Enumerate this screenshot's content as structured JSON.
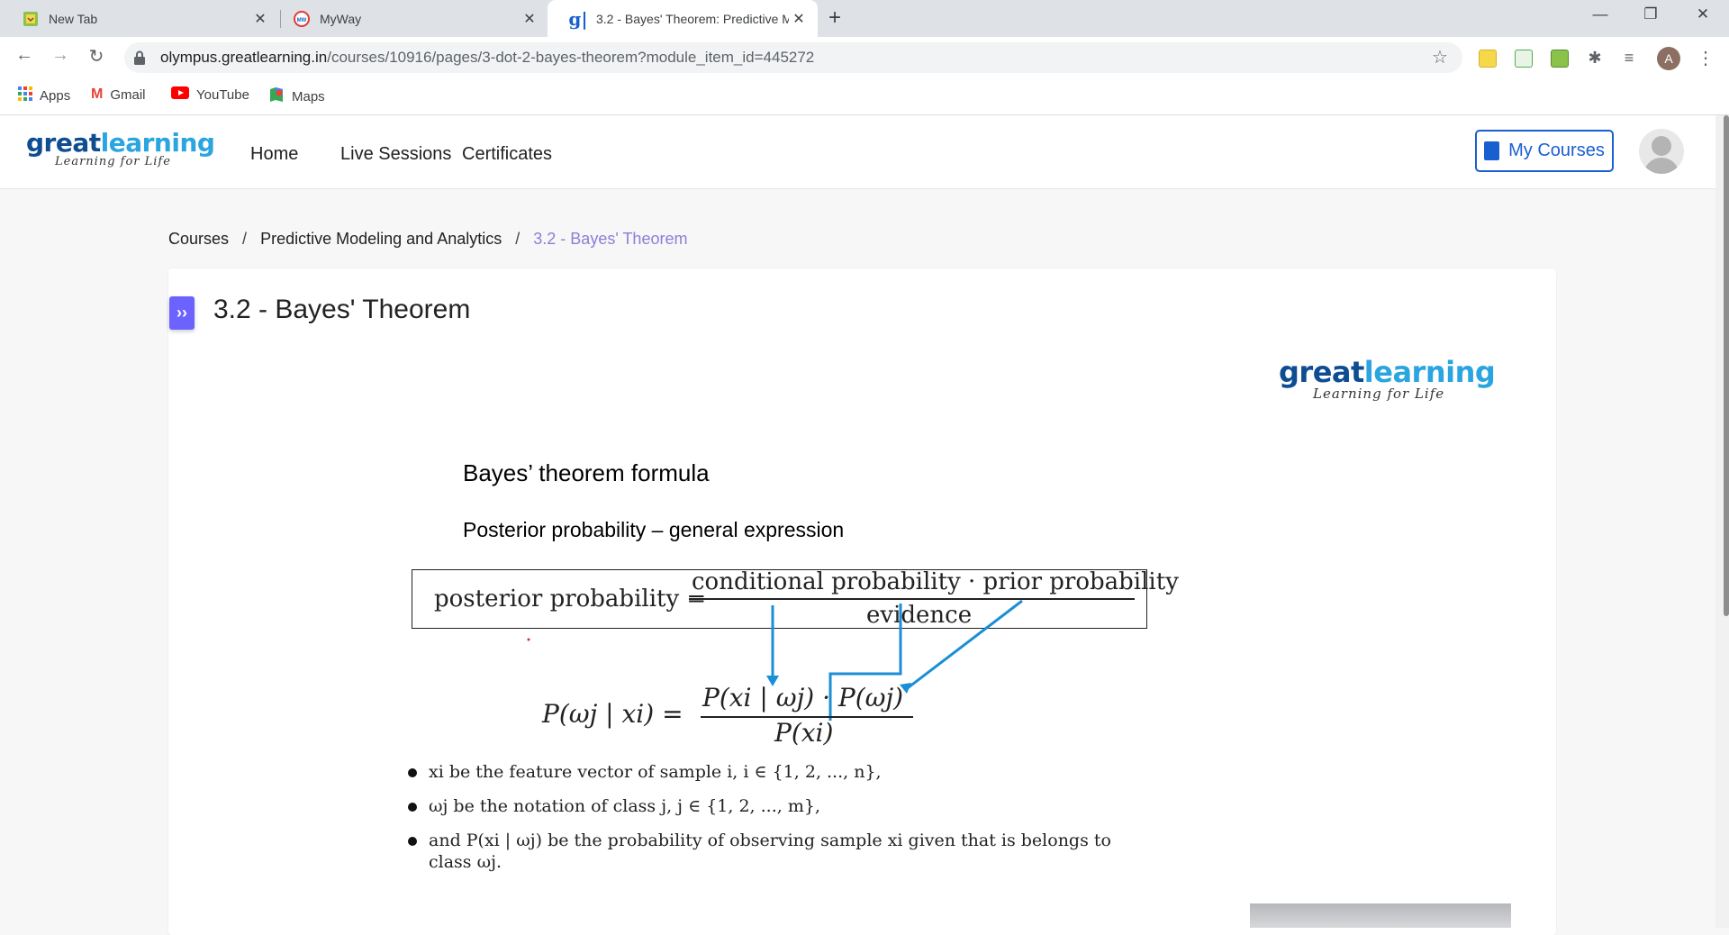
{
  "browser": {
    "tabs": [
      {
        "title": "New Tab",
        "close": "✕"
      },
      {
        "title": "MyWay",
        "close": "✕"
      },
      {
        "title": "3.2 - Bayes' Theorem: Predictive Mo",
        "close": "✕"
      }
    ],
    "new_tab": "+",
    "window_controls": {
      "minimize": "—",
      "restore": "❐",
      "close": "✕"
    },
    "url_host": "olympus.greatlearning.in",
    "url_path": "/courses/10916/pages/3-dot-2-bayes-theorem?module_item_id=445272",
    "profile_initial": "A",
    "bookmarks": [
      "Apps",
      "Gmail",
      "YouTube",
      "Maps"
    ]
  },
  "site": {
    "logo_main_a": "great",
    "logo_main_b": "learning",
    "logo_tagline": "Learning for Life",
    "nav": [
      "Home",
      "Live Sessions",
      "Certificates"
    ],
    "my_courses": "My Courses"
  },
  "breadcrumb": {
    "items": [
      "Courses",
      "Predictive Modeling and Analytics"
    ],
    "current": "3.2 - Bayes' Theorem",
    "separator": "/"
  },
  "page": {
    "expand_icon": "››",
    "title": "3.2 - Bayes' Theorem"
  },
  "slide": {
    "logo_main_a": "great",
    "logo_main_b": "learning",
    "logo_tagline": "Learning for Life",
    "heading": "Bayes’ theorem formula",
    "subheading": "Posterior probability – general expression",
    "formula_box": {
      "left": "posterior probability =",
      "numerator": "conditional probability · prior probability",
      "denominator": "evidence"
    },
    "equation": {
      "left": "P(ωj | xi) =",
      "numerator": "P(xi | ωj) · P(ωj)",
      "denominator": "P(xi)"
    },
    "bullets": [
      "xi be the feature vector of sample i, i ∈ {1, 2, ..., n},",
      "ωj be the notation of class j, j ∈ {1, 2, ..., m},",
      "and P(xi | ωj) be the probability of observing sample xi given that is belongs to class ωj."
    ]
  },
  "colors": {
    "accent_blue": "#1a5fd0",
    "arrow_blue": "#1a8fd6",
    "breadcrumb_current": "#8b7fd6",
    "expand_button": "#6c63ff",
    "logo_dark": "#0e4d92",
    "logo_light": "#2aa5e0"
  }
}
